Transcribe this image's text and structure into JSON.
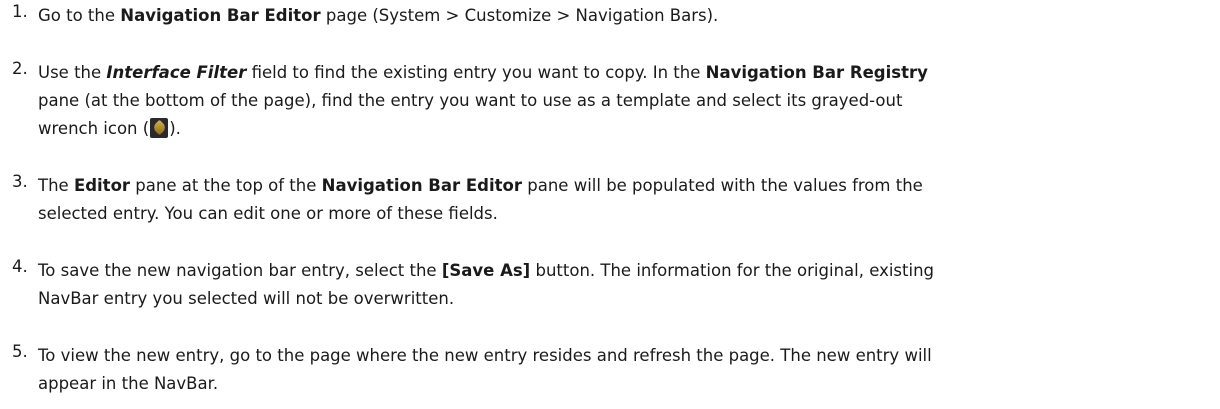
{
  "steps": [
    {
      "number": "1.",
      "t1": "Go to the ",
      "b1": "Navigation Bar Editor",
      "t2": " page (System > Customize > Navigation Bars)."
    },
    {
      "number": "2.",
      "t1": "Use the ",
      "bi1": "Interface Filter",
      "t2": " field to find the existing entry you want to copy. In the ",
      "b1": "Navigation Bar Registry",
      "t3": "pane (at the bottom of the page), find the entry you want to use as a template and select its grayed-out",
      "t4": "wrench icon (",
      "icon": "wrench-icon",
      "t5": ")."
    },
    {
      "number": "3.",
      "t1": "The ",
      "b1": "Editor",
      "t2": " pane at the top of the ",
      "b2": "Navigation Bar Editor",
      "t3": " pane will be populated with the values from the",
      "t4": "selected entry. You can edit one or more of these fields."
    },
    {
      "number": "4.",
      "t1": "To save the new navigation bar entry, select the ",
      "b1": "[Save As]",
      "t2": " button. The information for the original, existing",
      "t3": "NavBar entry you selected will not be overwritten."
    },
    {
      "number": "5.",
      "t1": "To view the new entry, go to the page where the new entry resides and refresh the page. The new entry will",
      "t2": "appear in the NavBar."
    }
  ]
}
